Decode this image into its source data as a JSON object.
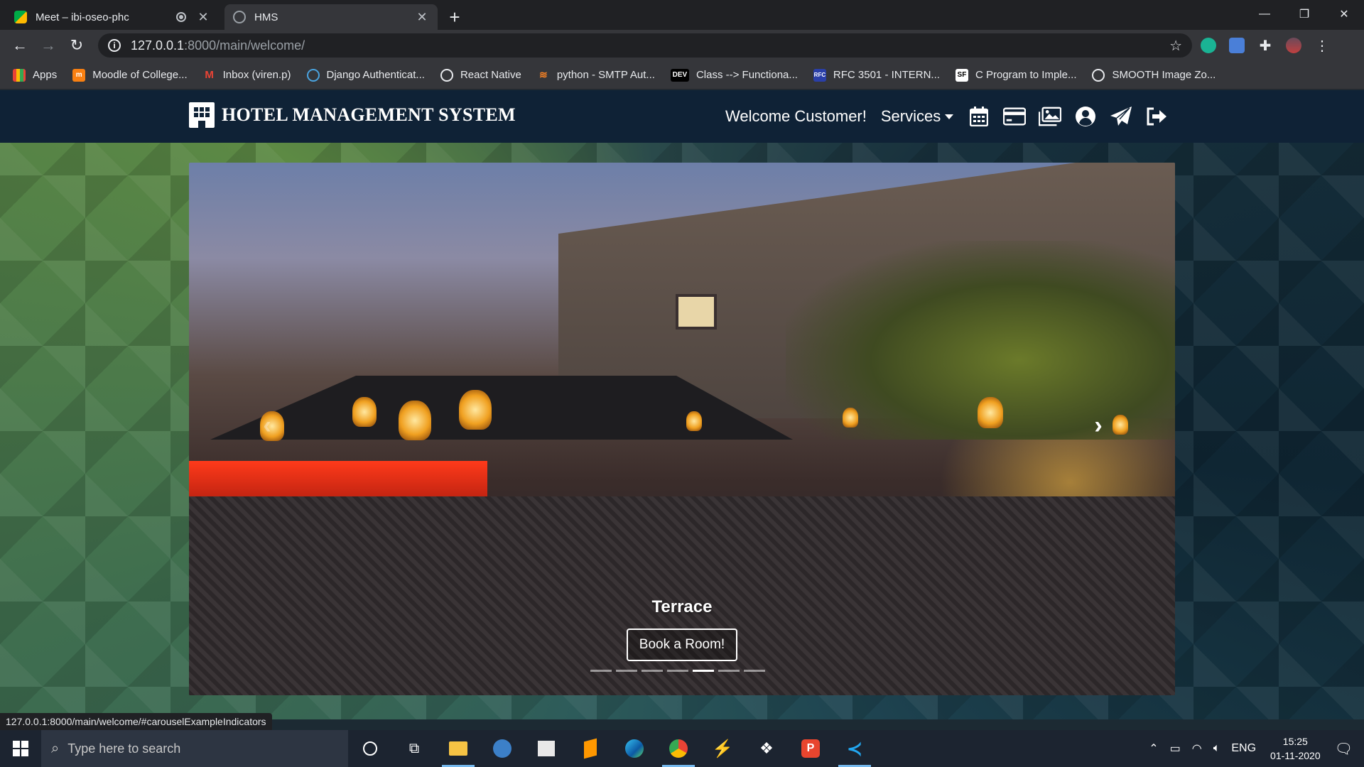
{
  "browser": {
    "tabs": [
      {
        "title": "Meet – ibi-oseo-phc",
        "active": false
      },
      {
        "title": "HMS",
        "active": true
      }
    ],
    "url_host": "127.0.0.1",
    "url_path": ":8000/main/welcome/",
    "bookmarks": [
      "Apps",
      "Moodle of College...",
      "Inbox (viren.p)",
      "Django Authenticat...",
      "React Native",
      "python - SMTP Aut...",
      "Class --> Functiona...",
      "RFC 3501 - INTERN...",
      "C Program to Imple...",
      "SMOOTH Image Zo..."
    ],
    "status_url": "127.0.0.1:8000/main/welcome/#carouselExampleIndicators"
  },
  "navbar": {
    "brand": "HOTEL MANAGEMENT SYSTEM",
    "welcome": "Welcome Customer!",
    "services": "Services"
  },
  "carousel": {
    "caption_title": "Terrace",
    "button_label": "Book a Room!",
    "indicator_count": 7,
    "active_indicator": 4
  },
  "taskbar": {
    "search_placeholder": "Type here to search",
    "language": "ENG",
    "time": "15:25",
    "date": "01-11-2020"
  },
  "colors": {
    "navbar_bg": "#0f2236",
    "browser_dark": "#202124",
    "browser_toolbar": "#35363a"
  }
}
